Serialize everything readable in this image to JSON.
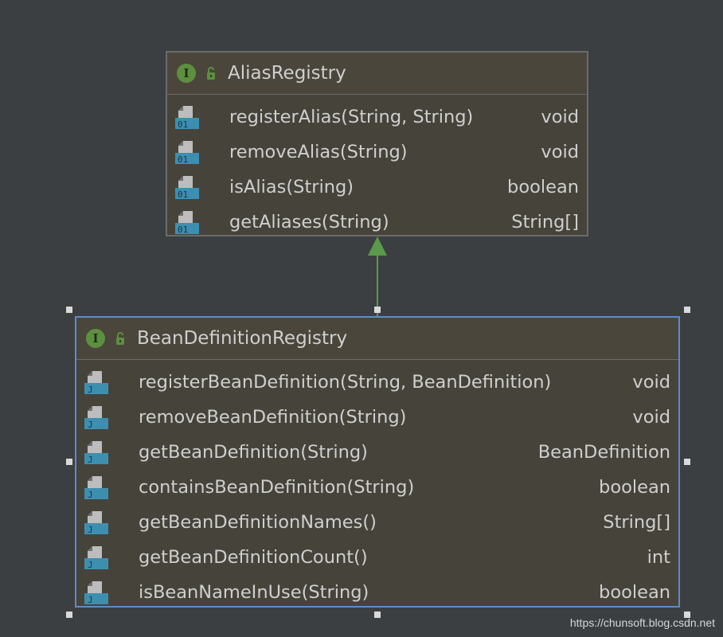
{
  "alias_registry": {
    "name": "AliasRegistry",
    "badge": "I",
    "methods": [
      {
        "name": "registerAlias(String, String)",
        "return": "void",
        "icon": "method-binary-icon",
        "icon_label": "01"
      },
      {
        "name": "removeAlias(String)",
        "return": "void",
        "icon": "method-binary-icon",
        "icon_label": "01"
      },
      {
        "name": "isAlias(String)",
        "return": "boolean",
        "icon": "method-binary-icon",
        "icon_label": "01"
      },
      {
        "name": "getAliases(String)",
        "return": "String[]",
        "icon": "method-binary-icon",
        "icon_label": "01"
      }
    ]
  },
  "bean_definition_registry": {
    "name": "BeanDefinitionRegistry",
    "badge": "I",
    "selected": true,
    "methods": [
      {
        "name": "registerBeanDefinition(String, BeanDefinition)",
        "return": "void",
        "icon": "method-java-icon",
        "icon_label": "J"
      },
      {
        "name": "removeBeanDefinition(String)",
        "return": "void",
        "icon": "method-java-icon",
        "icon_label": "J"
      },
      {
        "name": "getBeanDefinition(String)",
        "return": "BeanDefinition",
        "icon": "method-java-icon",
        "icon_label": "J"
      },
      {
        "name": "containsBeanDefinition(String)",
        "return": "boolean",
        "icon": "method-java-icon",
        "icon_label": "J"
      },
      {
        "name": "getBeanDefinitionNames()",
        "return": "String[]",
        "icon": "method-java-icon",
        "icon_label": "J"
      },
      {
        "name": "getBeanDefinitionCount()",
        "return": "int",
        "icon": "method-java-icon",
        "icon_label": "J"
      },
      {
        "name": "isBeanNameInUse(String)",
        "return": "boolean",
        "icon": "method-java-icon",
        "icon_label": "J"
      }
    ]
  },
  "relation": {
    "type": "extends",
    "from": "BeanDefinitionRegistry",
    "to": "AliasRegistry"
  },
  "watermark": "https://chunsoft.blog.csdn.net",
  "colors": {
    "background": "#3c3f41",
    "box_fill": "#46433a",
    "box_border": "#6b6b6b",
    "selection_border": "#5d8bd1",
    "interface_badge": "#5d8f3f",
    "arrow": "#5a9a4a",
    "method_icon": "#3d8fb0",
    "text": "#cfcfcf"
  }
}
